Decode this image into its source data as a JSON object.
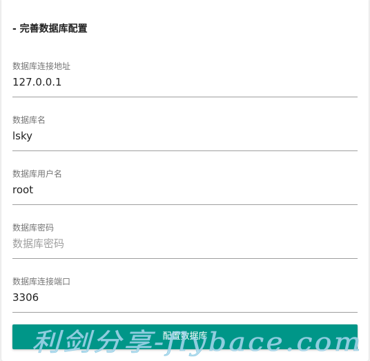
{
  "section": {
    "title": "- 完善数据库配置"
  },
  "fields": [
    {
      "label": "数据库连接地址",
      "value": "127.0.0.1",
      "placeholder": ""
    },
    {
      "label": "数据库名",
      "value": "lsky",
      "placeholder": ""
    },
    {
      "label": "数据库用户名",
      "value": "root",
      "placeholder": ""
    },
    {
      "label": "数据库密码",
      "value": "",
      "placeholder": "数据库密码"
    },
    {
      "label": "数据库连接端口",
      "value": "3306",
      "placeholder": ""
    }
  ],
  "submit": {
    "label": "配置数据库"
  },
  "watermark": {
    "text": "利剑分享-flybace.com"
  },
  "colors": {
    "accent": "#009688",
    "watermark": "#a8d8ec"
  }
}
